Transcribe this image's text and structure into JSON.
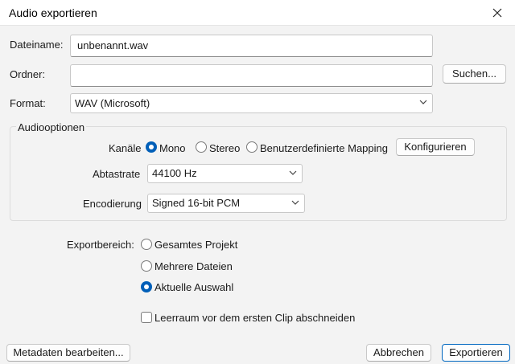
{
  "window": {
    "title": "Audio exportieren"
  },
  "filename": {
    "label": "Dateiname:",
    "value": "unbenannt.wav"
  },
  "folder": {
    "label": "Ordner:",
    "value": "",
    "browse_label": "Suchen..."
  },
  "format": {
    "label": "Format:",
    "selected": "WAV (Microsoft)"
  },
  "audio_options": {
    "title": "Audiooptionen",
    "channels": {
      "label": "Kanäle",
      "options": [
        "Mono",
        "Stereo",
        "Benutzerdefinierte Mapping"
      ],
      "selected": "Mono",
      "configure_label": "Konfigurieren"
    },
    "sample_rate": {
      "label": "Abtastrate",
      "selected": "44100 Hz"
    },
    "encoding": {
      "label": "Encodierung",
      "selected": "Signed 16-bit PCM"
    }
  },
  "export_range": {
    "label": "Exportbereich:",
    "options": [
      "Gesamtes Projekt",
      "Mehrere Dateien",
      "Aktuelle Auswahl"
    ],
    "selected": "Aktuelle Auswahl"
  },
  "trim_checkbox": {
    "label": "Leerraum vor dem ersten Clip abschneiden",
    "checked": false
  },
  "footer": {
    "metadata_label": "Metadaten bearbeiten...",
    "cancel_label": "Abbrechen",
    "export_label": "Exportieren"
  },
  "colors": {
    "accent": "#005fb8",
    "background": "#f3f3f3"
  }
}
